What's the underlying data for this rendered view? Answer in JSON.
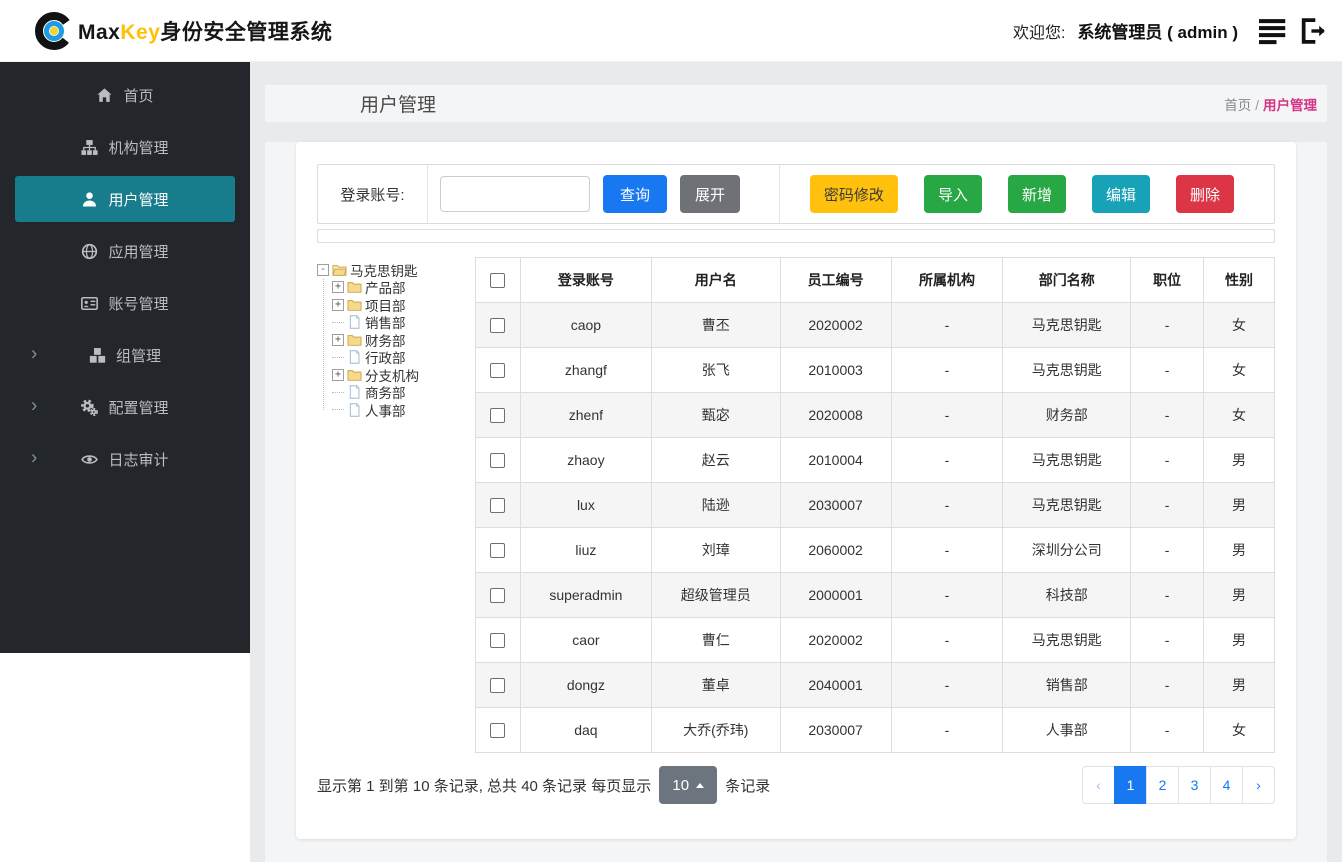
{
  "colors": {
    "accent_blue": "#1778f2",
    "active_teal": "#177c8c",
    "sidebar_bg": "#23272c",
    "warning_yellow": "#ffc10d",
    "success_green": "#28a745",
    "info_teal": "#17a2b8",
    "danger_red": "#dc3545",
    "breadcrumb_pink": "#d63384",
    "brand_yellow": "#ffc107"
  },
  "header": {
    "brand_max": "Max",
    "brand_key": "Key",
    "brand_suffix": "身份安全管理系统",
    "welcome_label": "欢迎您:",
    "user_name": "系统管理员 ( admin )",
    "icons": [
      "list-icon",
      "logout-icon"
    ]
  },
  "sidebar": {
    "items": [
      {
        "id": "home",
        "label": "首页",
        "icon": "home",
        "active": false,
        "chevron": false
      },
      {
        "id": "org",
        "label": "机构管理",
        "icon": "sitemap",
        "active": false,
        "chevron": false
      },
      {
        "id": "user",
        "label": "用户管理",
        "icon": "user",
        "active": true,
        "chevron": false
      },
      {
        "id": "app",
        "label": "应用管理",
        "icon": "globe",
        "active": false,
        "chevron": false
      },
      {
        "id": "account",
        "label": "账号管理",
        "icon": "id-card",
        "active": false,
        "chevron": false
      },
      {
        "id": "group",
        "label": "组管理",
        "icon": "cubes",
        "active": false,
        "chevron": true
      },
      {
        "id": "config",
        "label": "配置管理",
        "icon": "gears",
        "active": false,
        "chevron": true
      },
      {
        "id": "audit",
        "label": "日志审计",
        "icon": "eye",
        "active": false,
        "chevron": true
      }
    ]
  },
  "page": {
    "title": "用户管理",
    "breadcrumb": {
      "home": "首页",
      "separator": "/",
      "current": "用户管理"
    }
  },
  "search": {
    "label": "登录账号:",
    "input_value": "",
    "query_label": "查询",
    "expand_label": "展开",
    "actions": [
      {
        "label": "密码修改",
        "style": "warning"
      },
      {
        "label": "导入",
        "style": "success"
      },
      {
        "label": "新增",
        "style": "success"
      },
      {
        "label": "编辑",
        "style": "info"
      },
      {
        "label": "删除",
        "style": "danger"
      }
    ]
  },
  "tree": {
    "root": {
      "label": "马克思钥匙",
      "expander": "-",
      "icon": "folder-open"
    },
    "children": [
      {
        "label": "产品部",
        "type": "folder",
        "expander": "+"
      },
      {
        "label": "项目部",
        "type": "folder",
        "expander": "+"
      },
      {
        "label": "销售部",
        "type": "file"
      },
      {
        "label": "财务部",
        "type": "folder",
        "expander": "+"
      },
      {
        "label": "行政部",
        "type": "file"
      },
      {
        "label": "分支机构",
        "type": "folder",
        "expander": "+"
      },
      {
        "label": "商务部",
        "type": "file"
      },
      {
        "label": "人事部",
        "type": "file"
      }
    ]
  },
  "table": {
    "columns": [
      "登录账号",
      "用户名",
      "员工编号",
      "所属机构",
      "部门名称",
      "职位",
      "性别"
    ],
    "rows": [
      [
        "caop",
        "曹丕",
        "2020002",
        "-",
        "马克思钥匙",
        "-",
        "女"
      ],
      [
        "zhangf",
        "张飞",
        "2010003",
        "-",
        "马克思钥匙",
        "-",
        "女"
      ],
      [
        "zhenf",
        "甄宓",
        "2020008",
        "-",
        "财务部",
        "-",
        "女"
      ],
      [
        "zhaoy",
        "赵云",
        "2010004",
        "-",
        "马克思钥匙",
        "-",
        "男"
      ],
      [
        "lux",
        "陆逊",
        "2030007",
        "-",
        "马克思钥匙",
        "-",
        "男"
      ],
      [
        "liuz",
        "刘璋",
        "2060002",
        "-",
        "深圳分公司",
        "-",
        "男"
      ],
      [
        "superadmin",
        "超级管理员",
        "2000001",
        "-",
        "科技部",
        "-",
        "男"
      ],
      [
        "caor",
        "曹仁",
        "2020002",
        "-",
        "马克思钥匙",
        "-",
        "男"
      ],
      [
        "dongz",
        "董卓",
        "2040001",
        "-",
        "销售部",
        "-",
        "男"
      ],
      [
        "daq",
        "大乔(乔玮)",
        "2030007",
        "-",
        "人事部",
        "-",
        "女"
      ]
    ]
  },
  "pagination": {
    "summary_prefix": "显示第 1 到第 10 条记录, 总共 40 条记录 每页显示",
    "page_size": "10",
    "summary_suffix": "条记录",
    "prev": "‹",
    "next": "›",
    "pages": [
      "1",
      "2",
      "3",
      "4"
    ],
    "active_page": "1"
  }
}
